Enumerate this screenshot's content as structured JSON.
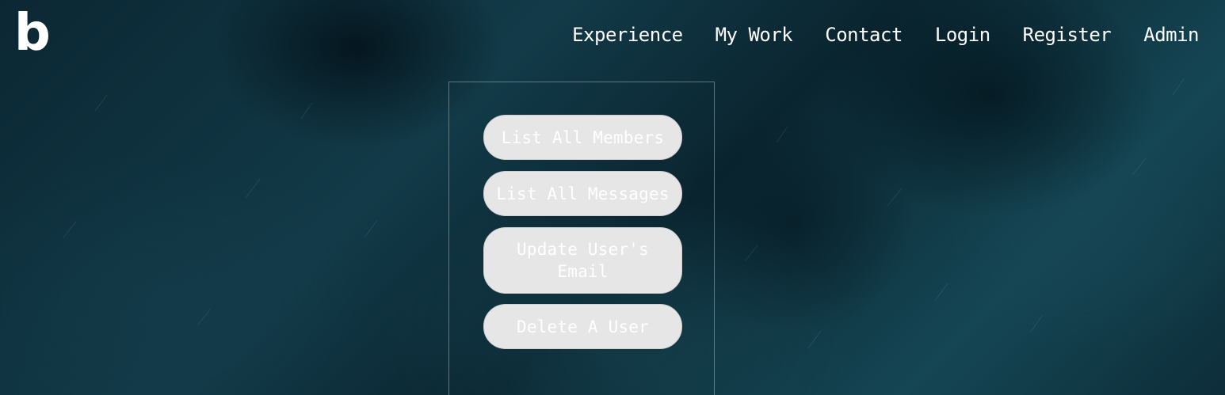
{
  "brand": {
    "logo_text": "b"
  },
  "nav": {
    "items": [
      {
        "label": "Experience"
      },
      {
        "label": "My Work"
      },
      {
        "label": "Contact"
      },
      {
        "label": "Login"
      },
      {
        "label": "Register"
      },
      {
        "label": "Admin"
      }
    ]
  },
  "admin_panel": {
    "buttons": [
      {
        "label": "List All Members"
      },
      {
        "label": "List All Messages"
      },
      {
        "label": "Update User's Email"
      },
      {
        "label": "Delete A User"
      }
    ]
  },
  "colors": {
    "background": "#0f3340",
    "button_bg": "#e6e6e6",
    "text": "#ffffff"
  }
}
